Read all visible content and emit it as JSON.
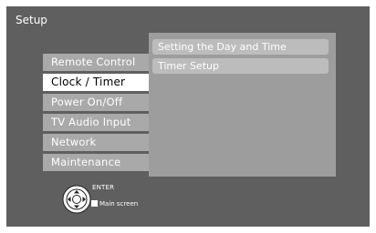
{
  "screen": {
    "title": "Setup"
  },
  "menu": {
    "items": [
      {
        "label": "Remote Control"
      },
      {
        "label": "Clock / Timer",
        "selected": true
      },
      {
        "label": "Power On/Off"
      },
      {
        "label": "TV Audio Input"
      },
      {
        "label": "Network"
      },
      {
        "label": "Maintenance"
      }
    ]
  },
  "submenu": {
    "items": [
      {
        "label": "Setting the Day and Time"
      },
      {
        "label": "Timer Setup"
      }
    ]
  },
  "hints": {
    "enter_label": "ENTER",
    "main_screen_label": "Main screen",
    "dpad_icon": "dpad-enter-icon",
    "stop_icon": "square-button-icon"
  },
  "colors": {
    "screen_bg": "#5f5f5f",
    "menu_item_bg": "#a9a9a9",
    "selected_bg": "#ffffff",
    "submenu_bg": "#9d9d9d",
    "submenu_item_bg": "#bcbcbc"
  }
}
